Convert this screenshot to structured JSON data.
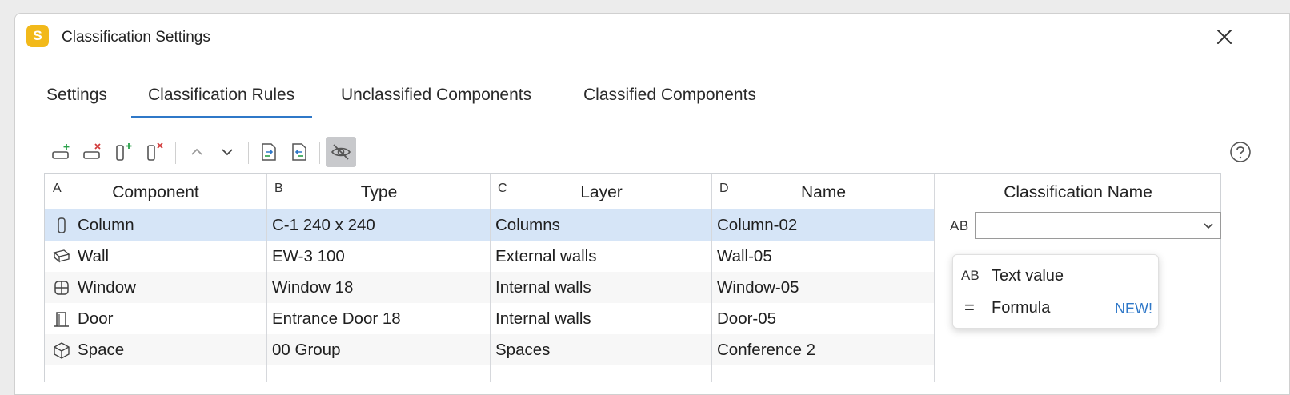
{
  "window": {
    "app_icon_letter": "S",
    "title": "Classification Settings",
    "accent_color": "#2f78c8",
    "app_icon_color": "#f2b91a"
  },
  "tabs": [
    {
      "label": "Settings",
      "active": false
    },
    {
      "label": "Classification Rules",
      "active": true
    },
    {
      "label": "Unclassified Components",
      "active": false
    },
    {
      "label": "Classified Components",
      "active": false
    }
  ],
  "toolbar": {
    "icons": [
      "add-row-icon",
      "delete-row-icon",
      "add-column-icon",
      "delete-column-icon",
      "move-up-icon",
      "move-down-icon",
      "import-icon",
      "export-icon",
      "hide-icon",
      "help-icon"
    ]
  },
  "grid": {
    "columns": [
      {
        "letter": "A",
        "title": "Component"
      },
      {
        "letter": "B",
        "title": "Type"
      },
      {
        "letter": "C",
        "title": "Layer"
      },
      {
        "letter": "D",
        "title": "Name"
      },
      {
        "letter": "",
        "title": "Classification Name"
      }
    ],
    "rows": [
      {
        "icon": "column-icon",
        "component": "Column",
        "type": "C-1 240 x 240",
        "layer": "Columns",
        "name": "Column-02",
        "selected": true
      },
      {
        "icon": "wall-icon",
        "component": "Wall",
        "type": "EW-3 100",
        "layer": "External walls",
        "name": "Wall-05",
        "selected": false
      },
      {
        "icon": "window-icon",
        "component": "Window",
        "type": "Window 18",
        "layer": "Internal walls",
        "name": "Window-05",
        "selected": false
      },
      {
        "icon": "door-icon",
        "component": "Door",
        "type": "Entrance Door 18",
        "layer": "Internal walls",
        "name": "Door-05",
        "selected": false
      },
      {
        "icon": "space-icon",
        "component": "Space",
        "type": "00 Group",
        "layer": "Spaces",
        "name": "Conference 2",
        "selected": false
      }
    ]
  },
  "classification_field": {
    "type_label": "AB",
    "value": ""
  },
  "dropdown_menu": {
    "items": [
      {
        "icon_text": "AB",
        "label": "Text value",
        "badge": ""
      },
      {
        "icon_text": "=",
        "label": "Formula",
        "badge": "NEW!"
      }
    ]
  }
}
